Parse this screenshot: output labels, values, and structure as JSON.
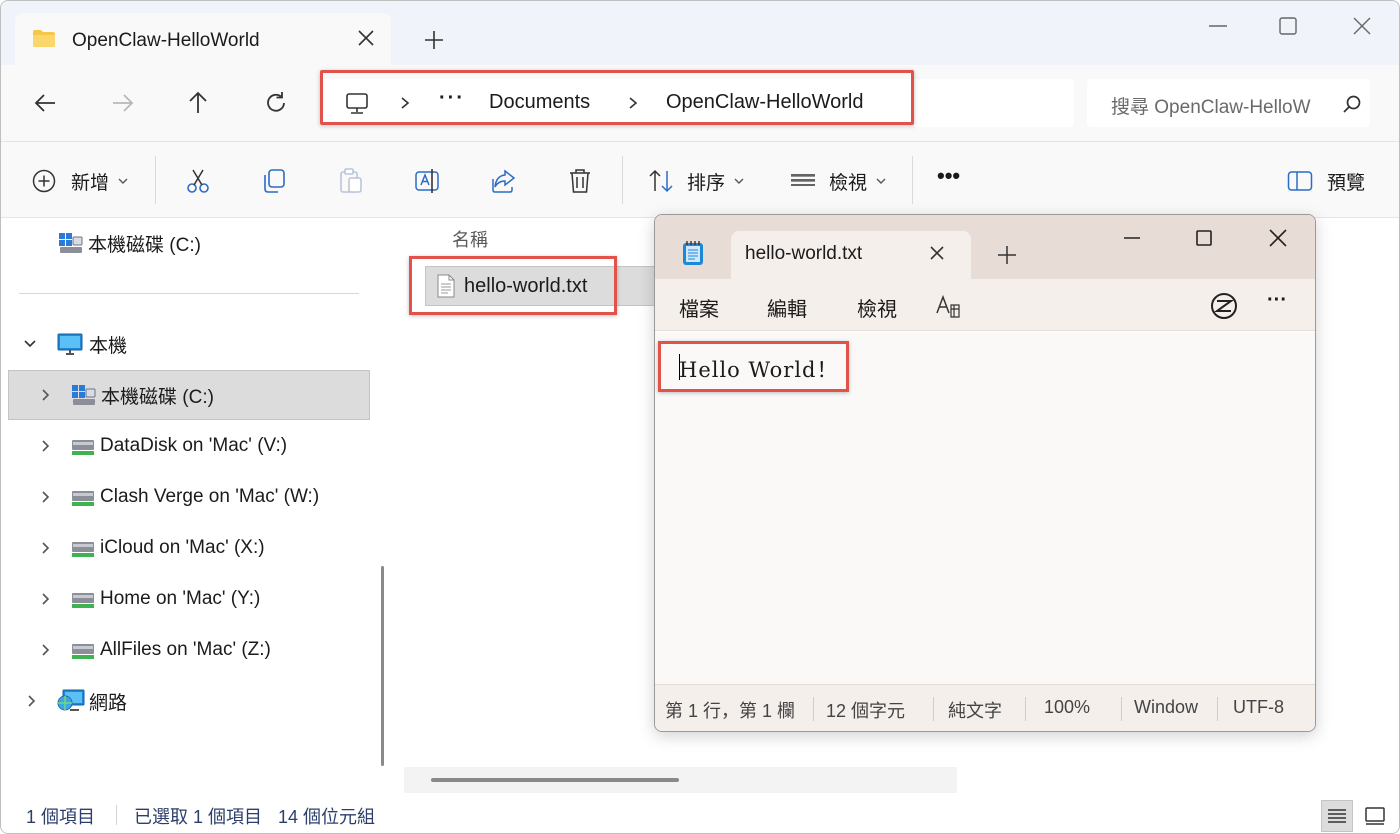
{
  "explorer": {
    "tab_title": "OpenClaw-HelloWorld",
    "breadcrumb": {
      "overflow": "···",
      "items": [
        "Documents",
        "OpenClaw-HelloWorld"
      ]
    },
    "search_placeholder": "搜尋 OpenClaw-HelloWorld",
    "commands": {
      "new": "新增",
      "sort": "排序",
      "view": "檢視",
      "more": "•••",
      "preview": "預覽"
    },
    "nav": {
      "quick_drive": "本機磁碟 (C:)",
      "this_pc": "本機",
      "drives": [
        "本機磁碟 (C:)",
        "DataDisk on 'Mac' (V:)",
        "Clash Verge on 'Mac' (W:)",
        "iCloud on 'Mac' (X:)",
        "Home on 'Mac' (Y:)",
        "AllFiles on 'Mac' (Z:)"
      ],
      "network": "網路"
    },
    "file_list": {
      "column_name": "名稱",
      "files": [
        "hello-world.txt"
      ]
    },
    "status": {
      "item_count": "1 個項目",
      "selection": "已選取 1 個項目",
      "size": "14 個位元組"
    }
  },
  "notepad": {
    "tab_title": "hello-world.txt",
    "menu": [
      "檔案",
      "編輯",
      "檢視"
    ],
    "content": "Hello World！",
    "status": {
      "position": "第 1 行，第 1 欄",
      "chars": "12 個字元",
      "format": "純文字",
      "zoom": "100%",
      "line_ending": "Window",
      "encoding": "UTF-8"
    }
  }
}
